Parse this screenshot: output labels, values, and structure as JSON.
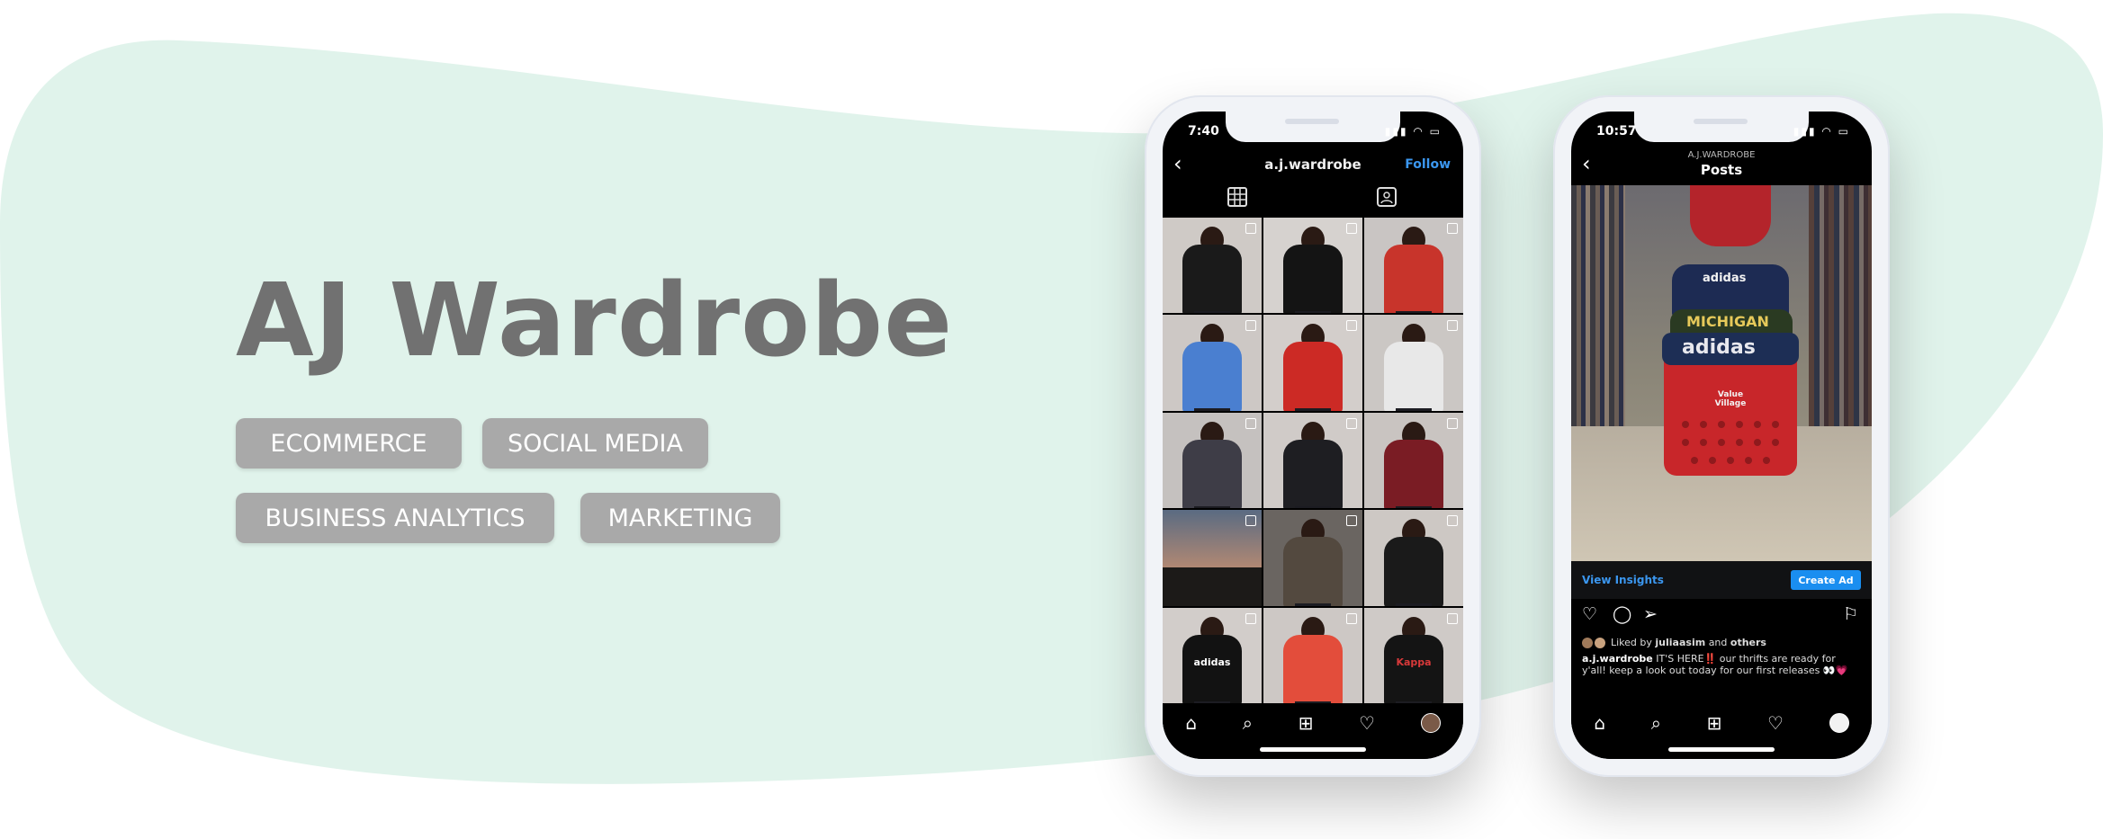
{
  "hero": {
    "title": "AJ Wardrobe",
    "tags": [
      "ECOMMERCE",
      "SOCIAL MEDIA",
      "BUSINESS ANALYTICS",
      "MARKETING"
    ]
  },
  "colors": {
    "blob": "#e0f3eb",
    "title": "#717171",
    "tag_bg": "#a9a9a9",
    "instagram_blue": "#3b97f0"
  },
  "phone1": {
    "time": "7:40",
    "username": "a.j.wardrobe",
    "follow": "Follow",
    "back_icon": "chevron-left-icon",
    "tabs": [
      "grid-icon",
      "tagged-icon"
    ],
    "nav": [
      "home-icon",
      "search-icon",
      "add-icon",
      "heart-icon",
      "profile-avatar"
    ]
  },
  "phone2": {
    "time": "10:57",
    "account": "A.J.WARDROBE",
    "title": "Posts",
    "view_insights": "View Insights",
    "create_ad": "Create Ad",
    "cart_label": "Value Village",
    "shirt_texts": [
      "adidas",
      "MICHIGAN",
      "adidas"
    ],
    "liked_by_prefix": "Liked by",
    "liked_by_user": "juliaasim",
    "liked_by_and": "and",
    "liked_by_others": "others",
    "caption_user": "a.j.wardrobe",
    "caption_text": "IT'S HERE‼️ our thrifts are ready for y'all! keep a look out today for our first releases 👀💗",
    "nav": [
      "home-icon",
      "search-icon",
      "add-icon",
      "heart-icon",
      "profile-avatar"
    ]
  },
  "grid_items": [
    {
      "shirt": "#1a1a1a",
      "logo": ""
    },
    {
      "shirt": "#141414",
      "logo": ""
    },
    {
      "shirt": "#c8342b",
      "logo": ""
    },
    {
      "shirt": "#4a7fd0",
      "logo": ""
    },
    {
      "shirt": "#cc2a25",
      "logo": ""
    },
    {
      "shirt": "#e8e8e8",
      "logo": ""
    },
    {
      "shirt": "#3e3d47",
      "logo": ""
    },
    {
      "shirt": "#1e1e22",
      "logo": ""
    },
    {
      "shirt": "#7a1c24",
      "logo": ""
    },
    {
      "shirt": "#e58c55",
      "logo": ""
    },
    {
      "shirt": "#53493f",
      "logo": ""
    },
    {
      "shirt": "#1a1a1a",
      "logo": ""
    },
    {
      "shirt": "#121212",
      "logo": "adidas"
    },
    {
      "shirt": "#e34d3b",
      "logo": ""
    },
    {
      "shirt": "#141414",
      "logo": "Kappa"
    }
  ]
}
